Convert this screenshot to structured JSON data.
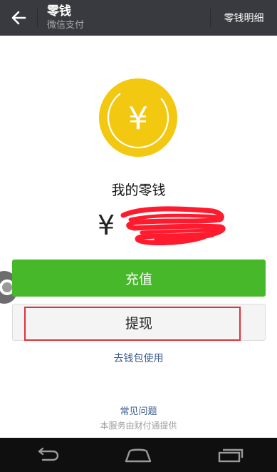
{
  "header": {
    "back_icon": "arrow-left-icon",
    "title": "零钱",
    "subtitle": "微信支付",
    "detail_button": "零钱明细"
  },
  "wallet": {
    "coin_icon": "yen-coin-icon",
    "coin_symbol": "¥",
    "label": "我的零钱",
    "currency_symbol": "¥",
    "amount_redacted": true
  },
  "actions": {
    "recharge": "充值",
    "withdraw": "提现",
    "wallet_link": "去钱包使用"
  },
  "footer": {
    "faq": "常见问题",
    "provider_note": "本服务由财付通提供"
  },
  "system_nav": {
    "back_icon": "nav-back-icon",
    "home_icon": "nav-home-icon",
    "recents_icon": "nav-recents-icon"
  },
  "colors": {
    "topbar": "#393a3f",
    "coin": "#f2c811",
    "primary_green": "#47b82a",
    "link_blue": "#3b5b8c",
    "highlight_red": "#e0333c",
    "redaction_red": "#ff1a2e"
  }
}
